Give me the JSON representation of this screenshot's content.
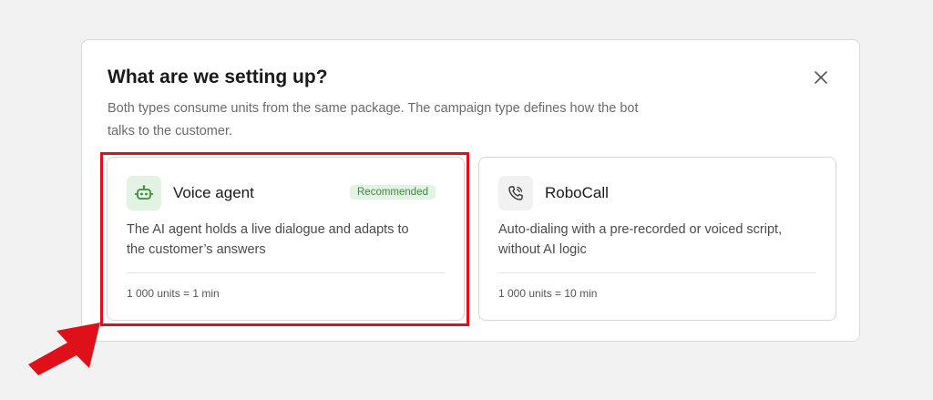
{
  "dialog": {
    "title": "What are we setting up?",
    "subtitle": "Both types consume units from the same package. The campaign type defines how the bot talks to the customer.",
    "close_icon": "close-icon"
  },
  "cards": [
    {
      "title": "Voice agent",
      "icon": "robot-icon",
      "badge": "Recommended",
      "description": "The AI agent holds a live dialogue and adapts to the customer’s answers",
      "meta": "1 000 units = 1 min",
      "highlighted": true
    },
    {
      "title": "RoboCall",
      "icon": "phone-icon",
      "description": "Auto-dialing with a pre-recorded or voiced script, without AI logic",
      "meta": "1 000 units = 10 min"
    }
  ],
  "colors": {
    "accent_green": "#3d8b3d",
    "badge_bg": "#e3f3e3",
    "annotation_red": "#e0101a"
  }
}
